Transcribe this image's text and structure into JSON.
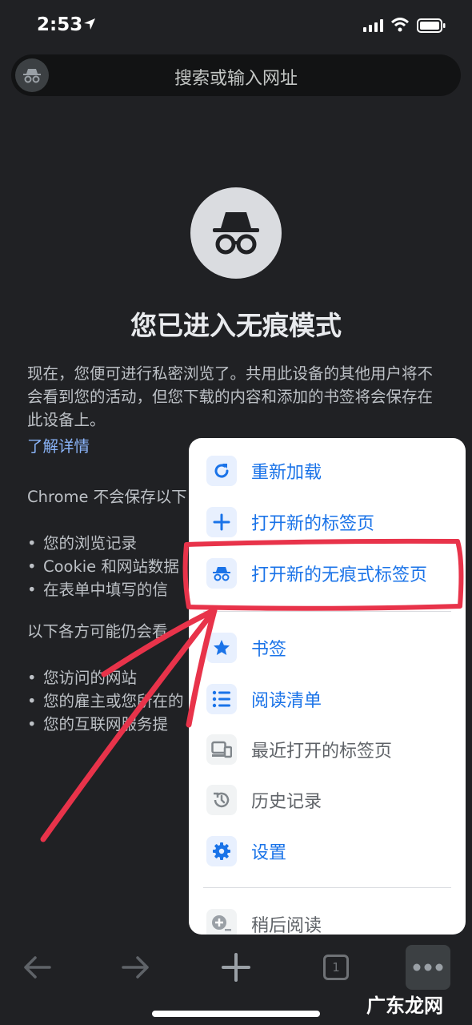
{
  "status_bar": {
    "time": "2:53"
  },
  "omnibox": {
    "placeholder": "搜索或输入网址"
  },
  "incognito": {
    "title": "您已进入无痕模式",
    "intro": "现在，您便可进行私密浏览了。共用此设备的其他用户将不会看到您的活动，但您下载的内容和添加的书签将会保存在此设备上。",
    "learn_more": "了解详情",
    "not_saved_heading": "Chrome 不会保存以下",
    "not_saved_items": [
      "您的浏览记录",
      "Cookie 和网站数据",
      "在表单中填写的信"
    ],
    "visible_heading": "以下各方可能仍会看",
    "visible_items": [
      "您访问的网站",
      "您的雇主或您所在的",
      "您的互联网服务提"
    ]
  },
  "menu": {
    "items": [
      {
        "label": "重新加载",
        "icon": "reload-icon",
        "enabled": true
      },
      {
        "label": "打开新的标签页",
        "icon": "plus-icon",
        "enabled": true
      },
      {
        "label": "打开新的无痕式标签页",
        "icon": "incognito-icon",
        "enabled": true
      },
      {
        "label": "书签",
        "icon": "star-icon",
        "enabled": true
      },
      {
        "label": "阅读清单",
        "icon": "list-icon",
        "enabled": true
      },
      {
        "label": "最近打开的标签页",
        "icon": "devices-icon",
        "enabled": false
      },
      {
        "label": "历史记录",
        "icon": "history-icon",
        "enabled": false
      },
      {
        "label": "设置",
        "icon": "gear-icon",
        "enabled": true
      },
      {
        "label": "稍后阅读",
        "icon": "add-reading-icon",
        "enabled": false
      }
    ]
  },
  "toolbar": {
    "tab_count": "1"
  },
  "watermark": "广东龙网",
  "colors": {
    "accent": "#1a73e8",
    "annotation": "#e8334a",
    "background": "#202124"
  }
}
